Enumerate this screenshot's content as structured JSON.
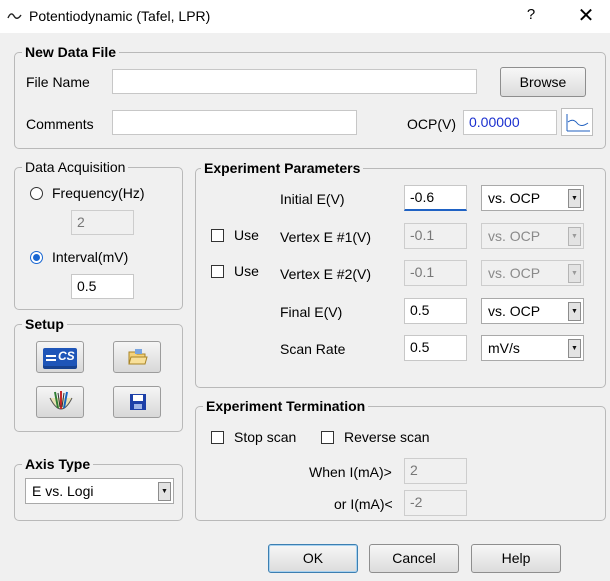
{
  "window": {
    "title": "Potentiodynamic (Tafel, LPR)",
    "help_label": "?",
    "close_label": "✕",
    "title_icon": "waveform-icon"
  },
  "new_data_file": {
    "legend": "New Data File",
    "file_name_label": "File Name",
    "file_name_value": "",
    "browse_label": "Browse",
    "comments_label": "Comments",
    "comments_value": "",
    "ocp_label": "OCP(V)",
    "ocp_value": "0.00000"
  },
  "data_acquisition": {
    "legend": "Data Acquisition",
    "frequency_label": "Frequency(Hz)",
    "frequency_value": "2",
    "interval_label": "Interval(mV)",
    "interval_value": "0.5",
    "selected": "interval"
  },
  "setup": {
    "legend": "Setup",
    "icons": [
      "cs-instrument-icon",
      "open-folder-icon",
      "electrode-cell-icon",
      "save-disk-icon"
    ],
    "cs_text": "CS"
  },
  "axis_type": {
    "legend": "Axis Type",
    "value": "E vs. Logi"
  },
  "experiment_parameters": {
    "legend": "Experiment Parameters",
    "use_label": "Use",
    "rows": [
      {
        "label": "Initial E(V)",
        "value": "-0.6",
        "ref": "vs. OCP"
      },
      {
        "label": "Vertex E #1(V)",
        "value": "-0.1",
        "ref": "vs. OCP"
      },
      {
        "label": "Vertex E #2(V)",
        "value": "-0.1",
        "ref": "vs. OCP"
      },
      {
        "label": "Final E(V)",
        "value": "0.5",
        "ref": "vs. OCP"
      },
      {
        "label": "Scan Rate",
        "value": "0.5",
        "ref": "mV/s"
      }
    ]
  },
  "experiment_termination": {
    "legend": "Experiment Termination",
    "stop_scan_label": "Stop scan",
    "reverse_scan_label": "Reverse scan",
    "when_label": "When I(mA)>",
    "when_value": "2",
    "or_label": "or I(mA)<",
    "or_value": "-2"
  },
  "footer": {
    "ok_label": "OK",
    "cancel_label": "Cancel",
    "help_label": "Help"
  },
  "colors": {
    "accent": "#1967d2",
    "ocp_text": "#1a2fcf",
    "background": "#f0f0f0"
  }
}
